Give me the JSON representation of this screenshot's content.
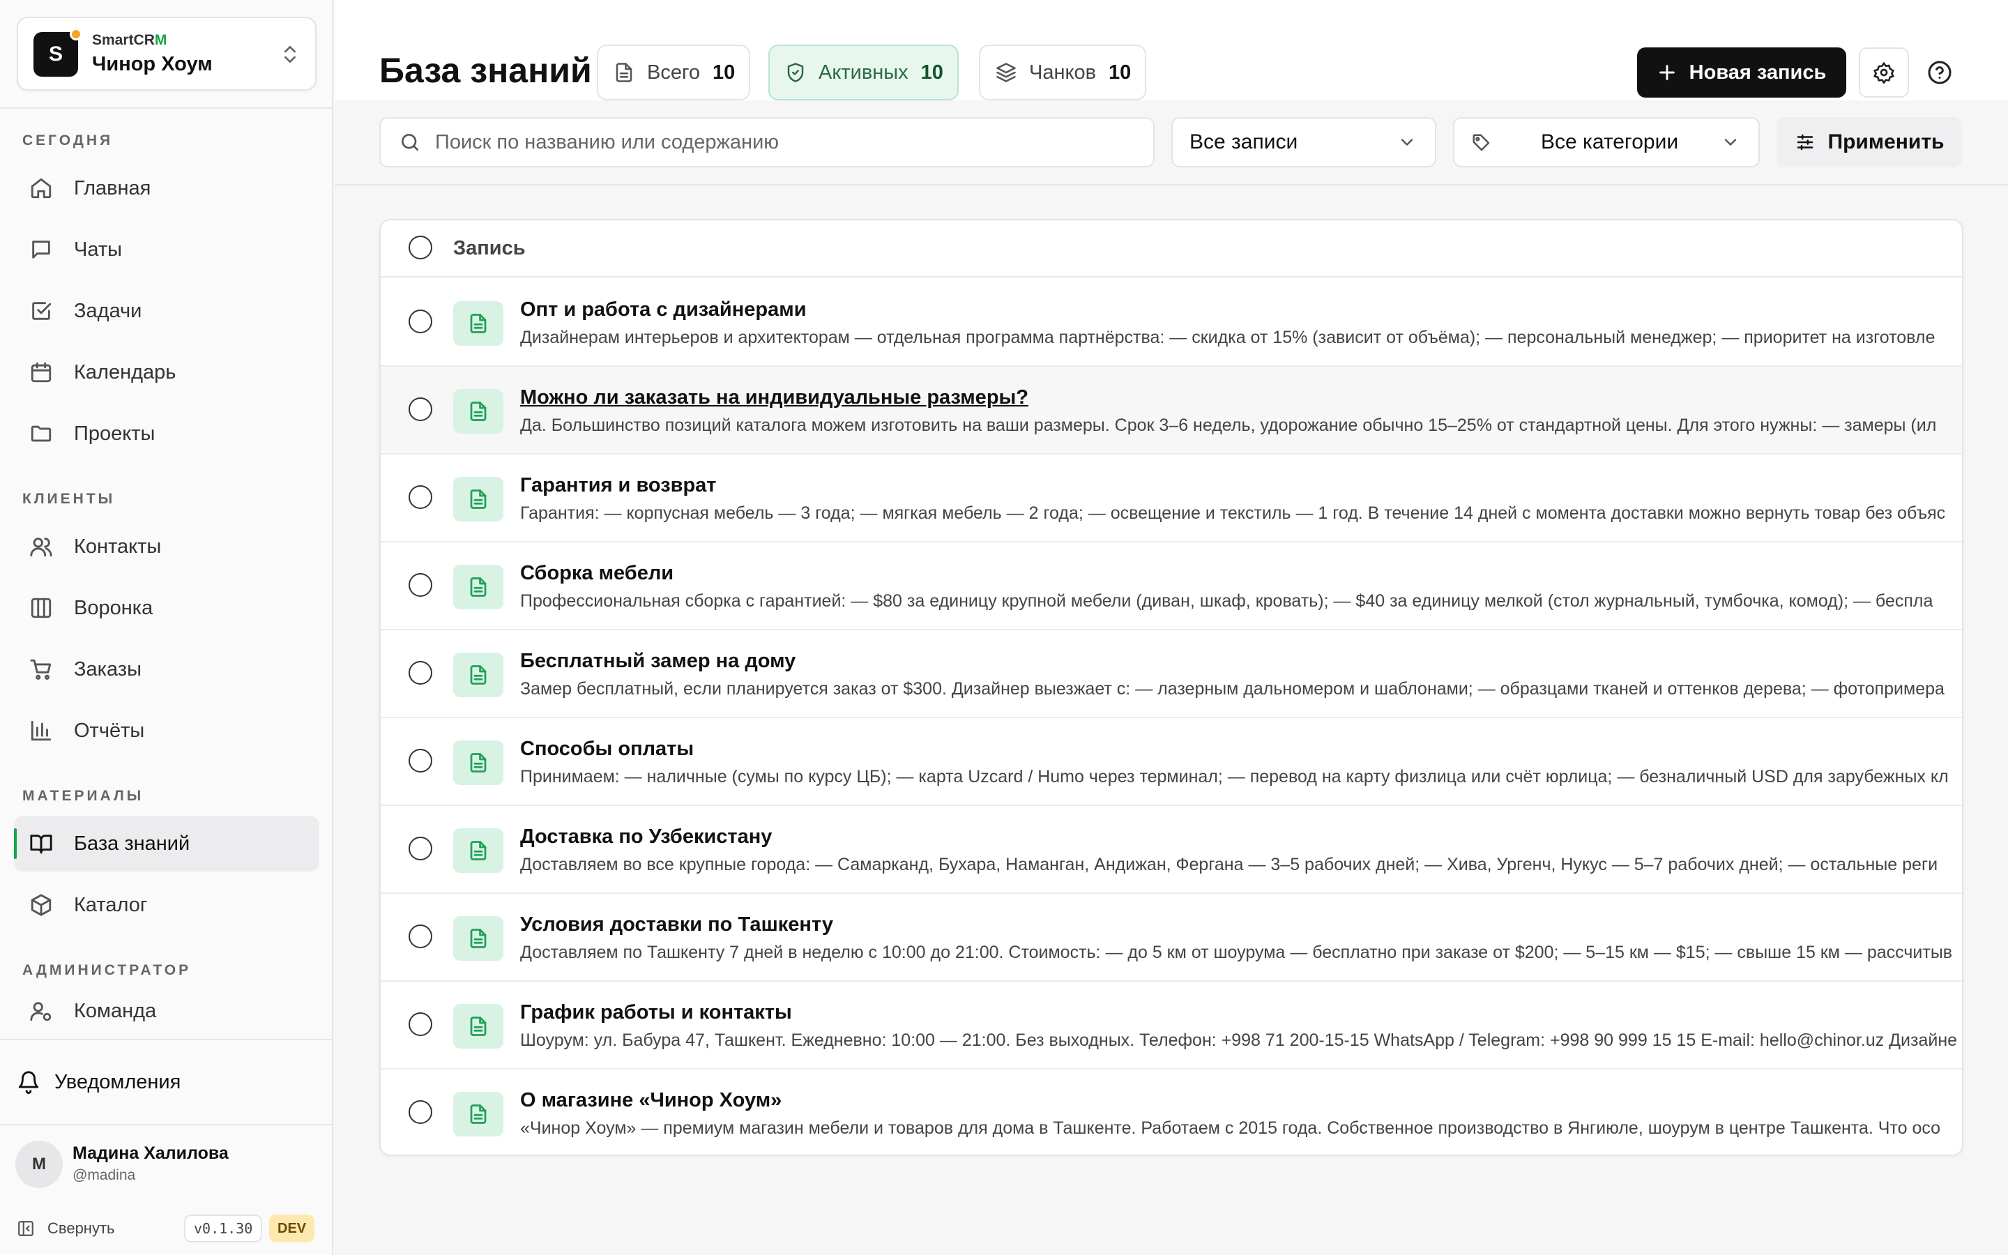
{
  "workspace": {
    "brand_prefix": "SmartCR",
    "brand_accent": "M",
    "name": "Чинор Хоум",
    "logo_letter": "S"
  },
  "sidebar": {
    "sections": {
      "today": "СЕГОДНЯ",
      "clients": "КЛИЕНТЫ",
      "materials": "МАТЕРИАЛЫ",
      "admin": "АДМИНИСТРАТОР"
    },
    "items": [
      {
        "label": "Главная",
        "icon": "home-icon"
      },
      {
        "label": "Чаты",
        "icon": "chat-icon"
      },
      {
        "label": "Задачи",
        "icon": "checkbox-icon"
      },
      {
        "label": "Календарь",
        "icon": "calendar-icon"
      },
      {
        "label": "Проекты",
        "icon": "folder-icon"
      },
      {
        "label": "Контакты",
        "icon": "users-icon"
      },
      {
        "label": "Воронка",
        "icon": "kanban-icon"
      },
      {
        "label": "Заказы",
        "icon": "cart-icon"
      },
      {
        "label": "Отчёты",
        "icon": "bar-chart-icon"
      },
      {
        "label": "База знаний",
        "icon": "book-icon",
        "active": true
      },
      {
        "label": "Каталог",
        "icon": "package-icon"
      },
      {
        "label": "Команда",
        "icon": "user-cog-icon"
      }
    ],
    "notifications": "Уведомления",
    "user": {
      "initial": "М",
      "name": "Мадина Халилова",
      "handle": "@madina"
    },
    "collapse": "Свернуть",
    "version": "v0.1.30",
    "env": "DEV"
  },
  "header": {
    "title": "База знаний",
    "stats": [
      {
        "label": "Всего",
        "value": "10",
        "icon": "file-icon"
      },
      {
        "label": "Активных",
        "value": "10",
        "icon": "shield-check-icon"
      },
      {
        "label": "Чанков",
        "value": "10",
        "icon": "layers-icon"
      }
    ],
    "new_button": "Новая запись"
  },
  "filters": {
    "search_placeholder": "Поиск по названию или содержанию",
    "status": "Все записи",
    "category": "Все категории",
    "apply": "Применить"
  },
  "table": {
    "header": "Запись",
    "rows": [
      {
        "title": "Опт и работа с дизайнерами",
        "desc": "Дизайнерам интерьеров и архитекторам — отдельная программа партнёрства: — скидка от 15% (зависит от объёма); — персональный менеджер; — приоритет на изготовле"
      },
      {
        "title": "Можно ли заказать на индивидуальные размеры?",
        "desc": "Да. Большинство позиций каталога можем изготовить на ваши размеры. Срок 3–6 недель, удорожание обычно 15–25% от стандартной цены. Для этого нужны: — замеры (ил"
      },
      {
        "title": "Гарантия и возврат",
        "desc": "Гарантия: — корпусная мебель — 3 года; — мягкая мебель — 2 года; — освещение и текстиль — 1 год. В течение 14 дней с момента доставки можно вернуть товар без объяс"
      },
      {
        "title": "Сборка мебели",
        "desc": "Профессиональная сборка с гарантией: — $80 за единицу крупной мебели (диван, шкаф, кровать); — $40 за единицу мелкой (стол журнальный, тумбочка, комод); — беспла"
      },
      {
        "title": "Бесплатный замер на дому",
        "desc": "Замер бесплатный, если планируется заказ от $300. Дизайнер выезжает с: — лазерным дальномером и шаблонами; — образцами тканей и оттенков дерева; — фотопримера"
      },
      {
        "title": "Способы оплаты",
        "desc": "Принимаем: — наличные (сумы по курсу ЦБ); — карта Uzcard / Humo через терминал; — перевод на карту физлица или счёт юрлица; — безналичный USD для зарубежных кл"
      },
      {
        "title": "Доставка по Узбекистану",
        "desc": "Доставляем во все крупные города: — Самарканд, Бухара, Наманган, Андижан, Фергана — 3–5 рабочих дней; — Хива, Ургенч, Нукус — 5–7 рабочих дней; — остальные реги"
      },
      {
        "title": "Условия доставки по Ташкенту",
        "desc": "Доставляем по Ташкенту 7 дней в неделю с 10:00 до 21:00. Стоимость: — до 5 км от шоурума — бесплатно при заказе от $200; — 5–15 км — $15; — свыше 15 км — рассчитыв"
      },
      {
        "title": "График работы и контакты",
        "desc": "Шоурум: ул. Бабура 47, Ташкент. Ежедневно: 10:00 — 21:00. Без выходных. Телефон: +998 71 200-15-15 WhatsApp / Telegram: +998 90 999 15 15 E-mail: hello@chinor.uz Дизайне"
      },
      {
        "title": "О магазине «Чинор Хоум»",
        "desc": "«Чинор Хоум» — премиум магазин мебели и товаров для дома в Ташкенте. Работаем с 2015 года. Собственное производство в Янгиюле, шоурум в центре Ташкента. Что осо"
      }
    ]
  },
  "colors": {
    "accent": "#16a34a",
    "active_badge_bg": "#e7f7ee",
    "doc_icon_bg": "#d8f3e3"
  }
}
